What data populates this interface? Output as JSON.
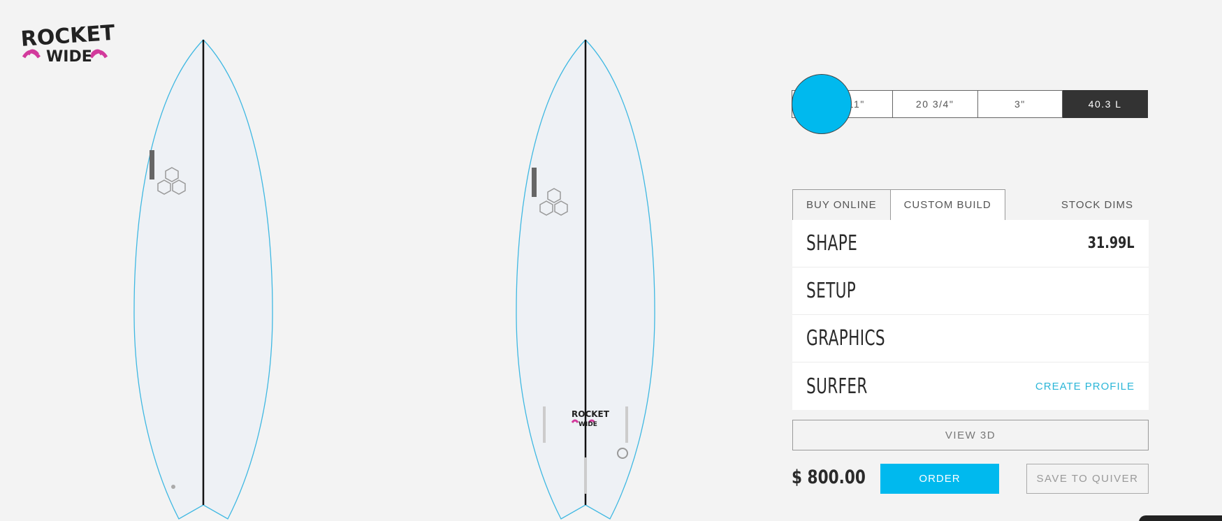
{
  "brand": {
    "logo_line1": "ROCKET",
    "logo_line2": "WIDE"
  },
  "board_color": "#00b9ee",
  "dims": [
    {
      "label": "5' 11\"",
      "active": false
    },
    {
      "label": "20 3/4\"",
      "active": false
    },
    {
      "label": "3\"",
      "active": false
    },
    {
      "label": "40.3 L",
      "active": true
    }
  ],
  "tabs": {
    "buy_online": "BUY ONLINE",
    "custom_build": "CUSTOM BUILD",
    "stock_dims": "STOCK DIMS"
  },
  "menu": {
    "shape": {
      "label": "SHAPE",
      "value": "31.99L"
    },
    "setup": {
      "label": "SETUP"
    },
    "graphics": {
      "label": "GRAPHICS"
    },
    "surfer": {
      "label": "SURFER",
      "link": "CREATE PROFILE"
    }
  },
  "actions": {
    "view_3d": "VIEW 3D",
    "price": "$ 800.00",
    "order": "ORDER",
    "save": "SAVE TO QUIVER"
  }
}
